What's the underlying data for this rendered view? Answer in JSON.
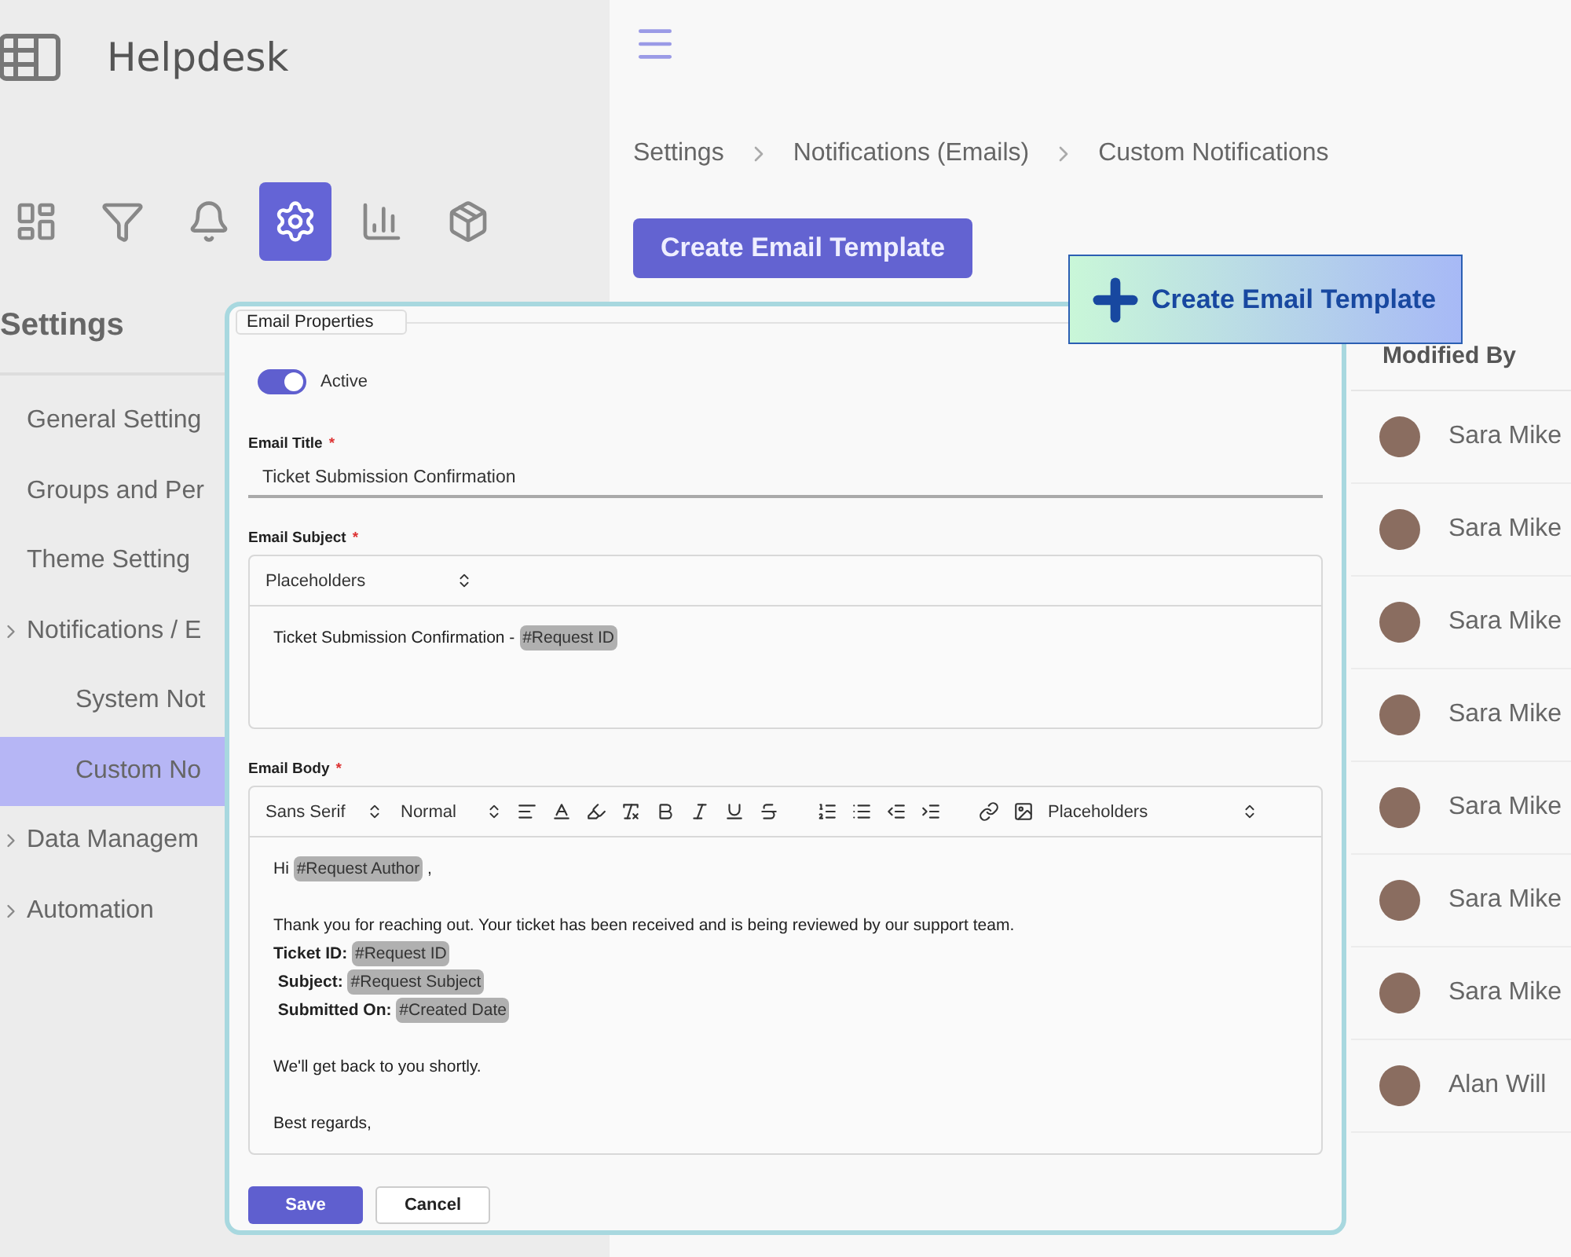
{
  "app": {
    "name": "Helpdesk"
  },
  "nav_icons": [
    {
      "selected": false
    },
    {
      "selected": false
    },
    {
      "selected": false
    },
    {
      "selected": true
    },
    {
      "selected": false
    },
    {
      "selected": false
    }
  ],
  "sidebar": {
    "title": "Settings",
    "items": [
      {
        "label": "General Setting",
        "selected": false,
        "expandable": false
      },
      {
        "label": "Groups and Per",
        "selected": false,
        "expandable": false
      },
      {
        "label": "Theme Setting",
        "selected": false,
        "expandable": false
      },
      {
        "label": "Notifications / E",
        "selected": false,
        "expandable": true,
        "children": [
          {
            "label": "System Not",
            "selected": false
          },
          {
            "label": "Custom No",
            "selected": true
          }
        ]
      },
      {
        "label": "Data Managem",
        "selected": false,
        "expandable": true
      },
      {
        "label": "Automation",
        "selected": false,
        "expandable": true
      }
    ]
  },
  "breadcrumb": [
    "Settings",
    "Notifications (Emails)",
    "Custom Notifications"
  ],
  "primary_button": "Create Email Template",
  "table": {
    "columns": [
      "Modified By"
    ],
    "rows": [
      {
        "modified_by": "Sara Mike"
      },
      {
        "modified_by": "Sara Mike"
      },
      {
        "modified_by": "Sara Mike"
      },
      {
        "modified_by": "Sara Mike"
      },
      {
        "modified_by": "Sara Mike"
      },
      {
        "modified_by": "Sara Mike"
      },
      {
        "modified_by": "Sara Mike"
      },
      {
        "modified_by": "Alan Will"
      }
    ]
  },
  "form": {
    "legend": "Email Properties",
    "active": {
      "label": "Active",
      "on": true
    },
    "title_field": {
      "label": "Email Title",
      "required_mark": "*",
      "value": "Ticket Submission Confirmation"
    },
    "subject": {
      "label": "Email Subject",
      "required_mark": "*",
      "placeholder_select": "Placeholders",
      "content": [
        {
          "kind": "text",
          "text": "Ticket Submission Confirmation - "
        },
        {
          "kind": "tag",
          "text": "#Request ID"
        }
      ]
    },
    "body": {
      "label": "Email Body",
      "required_mark": "*",
      "font": "Sans Serif",
      "size": "Normal",
      "placeholder_select": "Placeholders",
      "paragraphs": [
        {
          "lines": [
            {
              "parts": [
                {
                  "kind": "text",
                  "text": "Hi "
                },
                {
                  "kind": "tag",
                  "text": "#Request Author"
                },
                {
                  "kind": "text",
                  "text": " ,"
                }
              ]
            }
          ]
        },
        {
          "lines": [
            {
              "parts": [
                {
                  "kind": "text",
                  "text": "Thank you for reaching out. Your ticket has been received and is being reviewed by our support team."
                }
              ]
            },
            {
              "parts": [
                {
                  "kind": "bold",
                  "text": "Ticket ID: "
                },
                {
                  "kind": "tag",
                  "text": "#Request ID"
                }
              ]
            },
            {
              "parts": [
                {
                  "kind": "bold",
                  "text": " Subject: "
                },
                {
                  "kind": "tag",
                  "text": "#Request Subject"
                }
              ]
            },
            {
              "parts": [
                {
                  "kind": "bold",
                  "text": " Submitted On: "
                },
                {
                  "kind": "tag",
                  "text": "#Created Date"
                }
              ]
            }
          ]
        },
        {
          "lines": [
            {
              "parts": [
                {
                  "kind": "text",
                  "text": "We'll get back to you shortly."
                }
              ]
            }
          ]
        },
        {
          "lines": [
            {
              "parts": [
                {
                  "kind": "text",
                  "text": "Best regards,"
                }
              ]
            }
          ]
        }
      ]
    },
    "buttons": [
      {
        "label": "Save",
        "kind": "primary"
      },
      {
        "label": "Cancel",
        "kind": "secondary"
      }
    ]
  },
  "callout": {
    "label": "Create Email Template"
  }
}
